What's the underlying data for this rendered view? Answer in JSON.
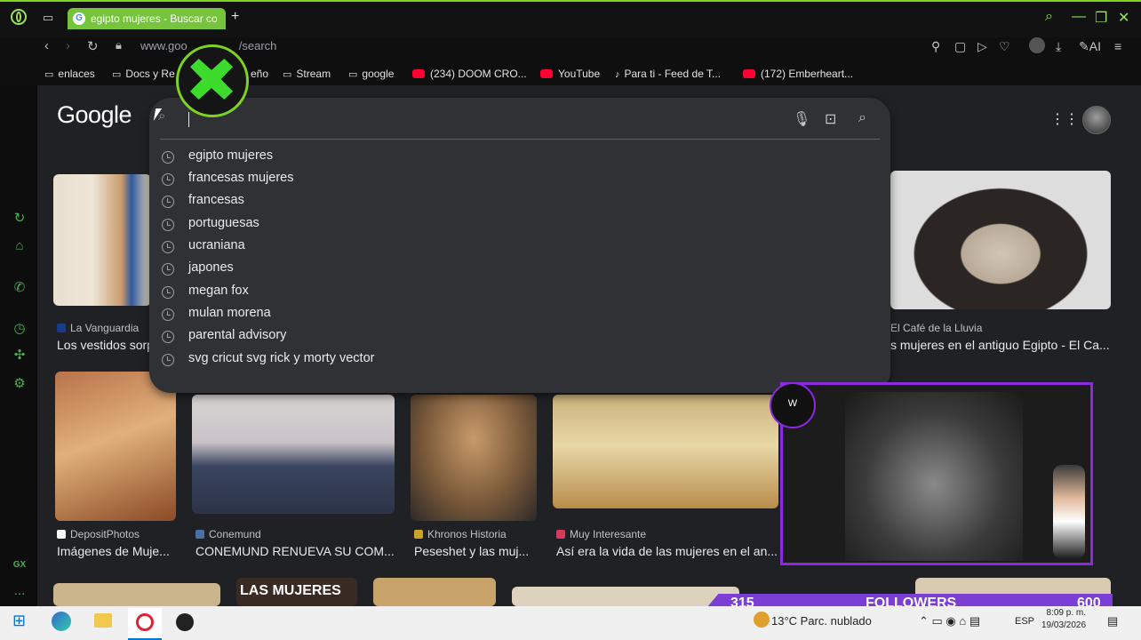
{
  "browser": {
    "tab_title": "egipto mujeres - Buscar co",
    "tab_favicon": "G",
    "new_tab": "+",
    "url": "www.google.com/search",
    "url_visible": "www.goo",
    "url_tail": "/search",
    "window_controls": [
      "search-icon",
      "minimize-icon",
      "maximize-icon",
      "close-icon"
    ],
    "toolbar_right": [
      "pin-icon",
      "snapshot-icon",
      "play-icon",
      "heart-icon",
      "extension-icon",
      "download-icon"
    ],
    "ai_label": "AI"
  },
  "bookmarks": [
    {
      "label": "enlaces",
      "icon": "folder-icon"
    },
    {
      "label": "Docs y Re",
      "icon": "folder-icon"
    },
    {
      "label": "eño",
      "icon": "folder-icon"
    },
    {
      "label": "Stream",
      "icon": "folder-icon"
    },
    {
      "label": "google",
      "icon": "folder-icon"
    },
    {
      "label": "(234) DOOM CRO...",
      "icon": "youtube-icon"
    },
    {
      "label": "YouTube",
      "icon": "youtube-icon"
    },
    {
      "label": "Para ti - Feed de T...",
      "icon": "tiktok-icon"
    },
    {
      "label": "(172) Emberheart...",
      "icon": "youtube-icon"
    }
  ],
  "google": {
    "logo": "Google",
    "suggestions": [
      "egipto mujeres",
      "francesas mujeres",
      "francesas",
      "portuguesas",
      "ucraniana",
      "japones",
      "megan fox",
      "mulan morena",
      "parental advisory",
      "svg cricut svg rick y morty vector"
    ]
  },
  "results_row1": [
    {
      "source": "La Vanguardia",
      "title": "Los vestidos sorp",
      "fav_color": "#1a3a8a"
    },
    {
      "source": "El Café de la Lluvia",
      "title": "s mujeres en el antiguo Egipto - El Ca...",
      "fav_color": "#202124"
    }
  ],
  "results_row2": [
    {
      "source": "DepositPhotos",
      "title": "Imágenes de Muje...",
      "fav_color": "#ffffff"
    },
    {
      "source": "Conemund",
      "title": "CONEMUND RENUEVA SU COM...",
      "fav_color": "#4a6fa5"
    },
    {
      "source": "Khronos Historia",
      "title": "Peseshet y las muj...",
      "fav_color": "#c9a227"
    },
    {
      "source": "Muy Interesante",
      "title": "Así era la vida de las mujeres en el an...",
      "fav_color": "#d63a5a"
    }
  ],
  "thumb_text": "LAS MUJERES",
  "stream": {
    "followers_count": "315",
    "followers_label": "FOLLOWERS",
    "followers_goal": "600"
  },
  "taskbar": {
    "weather": "13°C  Parc. nublado",
    "lang": "ESP",
    "time": "8:09 p. m.",
    "date": "19/03/2026"
  },
  "sidebar_bottom": "GX",
  "sidebar_more": "..."
}
